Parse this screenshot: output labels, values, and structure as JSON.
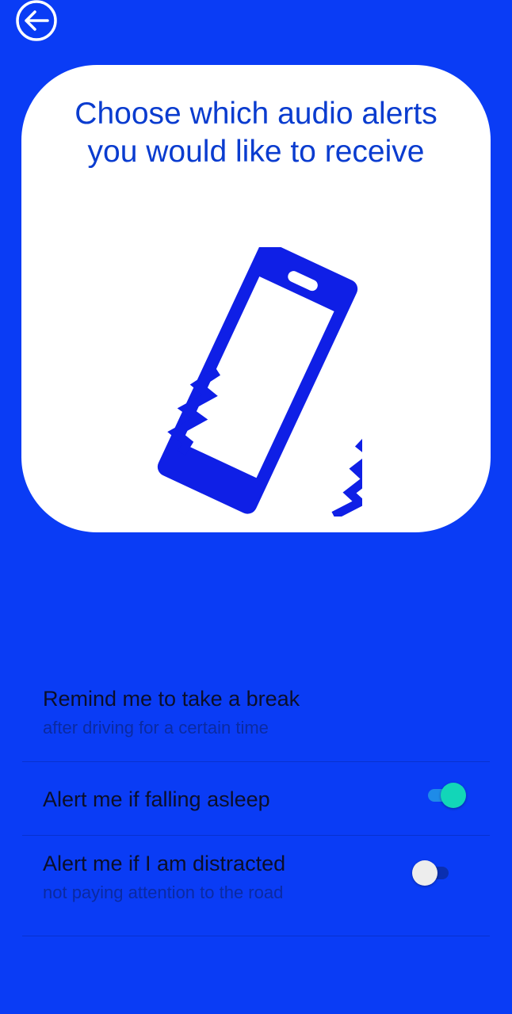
{
  "colors": {
    "background": "#0A3CF5",
    "card": "#FFFFFF",
    "accent": "#0A3CCF",
    "toggle_on_knob": "#12D6B8"
  },
  "header": {
    "back_icon": "arrow-left-circle-icon"
  },
  "card": {
    "title": "Choose which audio alerts you would like to receive",
    "illustration_icon": "vibrating-phone-icon"
  },
  "settings": [
    {
      "title": "Remind me to take a break",
      "subtitle": "after driving for a certain time"
    },
    {
      "title": "Alert me if falling asleep",
      "toggle": "on"
    },
    {
      "title": "Alert me if I am distracted",
      "subtitle": "not paying attention to the road",
      "toggle": "off"
    }
  ]
}
